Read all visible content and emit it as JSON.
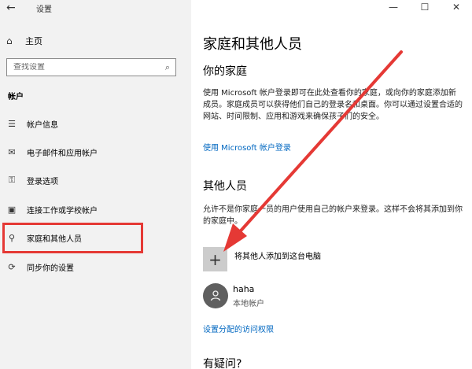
{
  "window": {
    "title": "设置",
    "back_glyph": "←",
    "min_glyph": "—",
    "max_glyph": "☐",
    "close_glyph": "✕"
  },
  "sidebar": {
    "home": {
      "icon": "home-icon",
      "glyph": "⌂",
      "label": "主页"
    },
    "search": {
      "placeholder": "查找设置",
      "icon": "search-icon"
    },
    "section": "帐户",
    "items": [
      {
        "id": "account-info",
        "icon": "person-card-icon",
        "glyph": "☰",
        "label": "帐户信息"
      },
      {
        "id": "email-accounts",
        "icon": "mail-icon",
        "glyph": "✉",
        "label": "电子邮件和应用帐户"
      },
      {
        "id": "signin-options",
        "icon": "key-icon",
        "glyph": "⚿",
        "label": "登录选项"
      },
      {
        "id": "work-school",
        "icon": "briefcase-icon",
        "glyph": "▣",
        "label": "连接工作或学校帐户"
      },
      {
        "id": "family-others",
        "icon": "person-icon",
        "glyph": "⚲",
        "label": "家庭和其他人员"
      },
      {
        "id": "sync",
        "icon": "sync-icon",
        "glyph": "⟳",
        "label": "同步你的设置"
      }
    ]
  },
  "main": {
    "title": "家庭和其他人员",
    "family": {
      "heading": "你的家庭",
      "description": "使用 Microsoft 帐户登录即可在此处查看你的家庭，或向你的家庭添加新成员。家庭成员可以获得他们自己的登录名和桌面。你可以通过设置合适的网站、时间限制、应用和游戏来确保孩子们的安全。",
      "link": "使用 Microsoft 帐户登录"
    },
    "others": {
      "heading": "其他人员",
      "description": "允许不是你家庭一员的用户使用自己的帐户来登录。这样不会将其添加到你的家庭中。",
      "add_label": "将其他人添加到这台电脑",
      "add_glyph": "+",
      "user": {
        "name": "haha",
        "type": "本地帐户",
        "avatar_glyph": "👤"
      },
      "assigned_access_link": "设置分配的访问权限"
    },
    "questions_heading": "有疑问?"
  },
  "colors": {
    "accent_link": "#0067c0",
    "annotation_red": "#e53935",
    "sidebar_bg": "#f2f2f2"
  }
}
